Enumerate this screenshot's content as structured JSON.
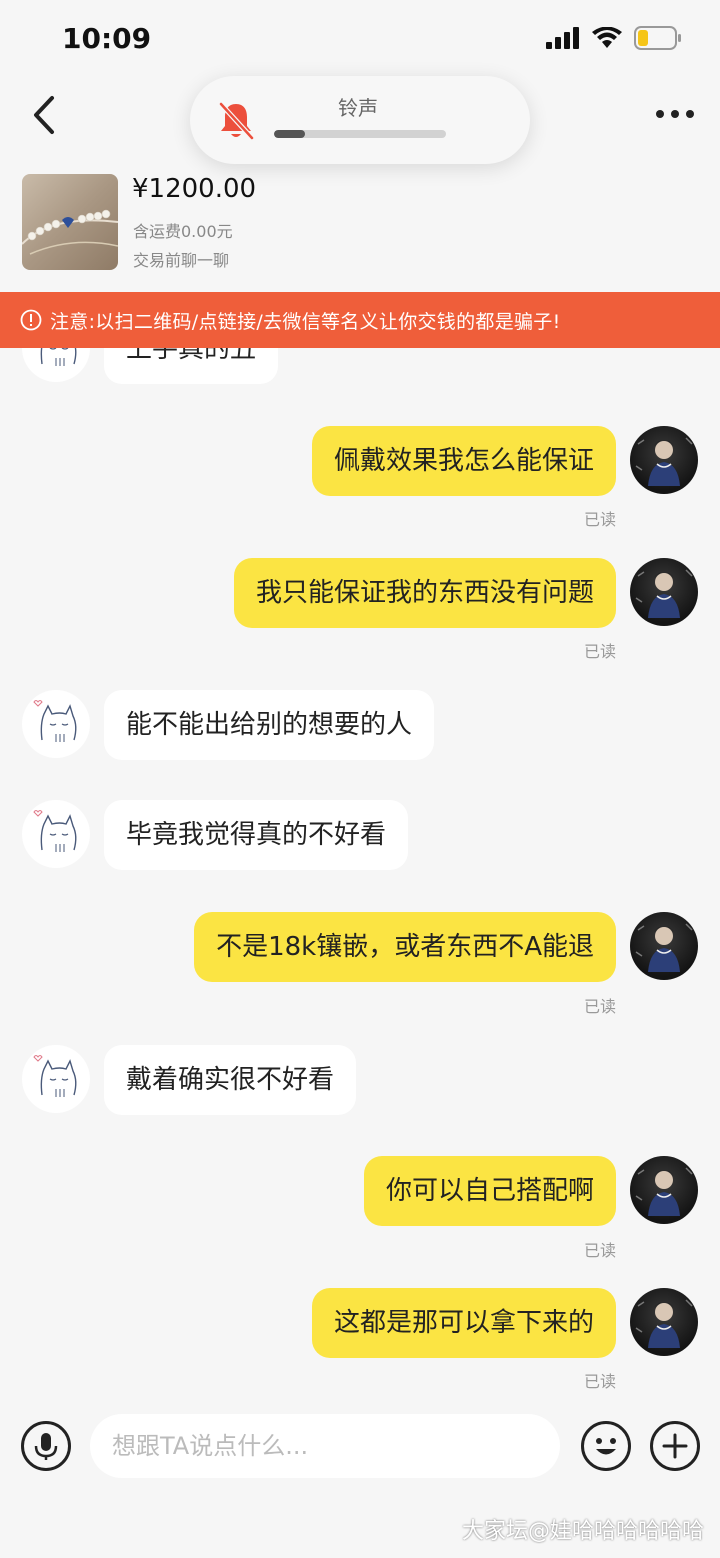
{
  "status_bar": {
    "time": "10:09"
  },
  "ringer": {
    "label": "铃声",
    "level": 0.18
  },
  "product": {
    "price": "¥1200.00",
    "shipping": "含运费0.00元",
    "chat_before_trade": "交易前聊一聊"
  },
  "warning": {
    "text": "注意:以扫二维码/点链接/去微信等名义让你交钱的都是骗子!"
  },
  "messages": [
    {
      "from": "other",
      "text": "上手真的丑"
    },
    {
      "from": "me",
      "text": "佩戴效果我怎么能保证",
      "status": "已读"
    },
    {
      "from": "me",
      "text": "我只能保证我的东西没有问题",
      "status": "已读"
    },
    {
      "from": "other",
      "text": "能不能出给别的想要的人"
    },
    {
      "from": "other",
      "text": "毕竟我觉得真的不好看"
    },
    {
      "from": "me",
      "text": "不是18k镶嵌，或者东西不A能退",
      "status": "已读"
    },
    {
      "from": "other",
      "text": "戴着确实很不好看"
    },
    {
      "from": "me",
      "text": "你可以自己搭配啊",
      "status": "已读"
    },
    {
      "from": "me",
      "text": "这都是那可以拿下来的",
      "status": "已读"
    }
  ],
  "input": {
    "placeholder": "想跟TA说点什么..."
  },
  "watermark": "大家坛@娃哈哈哈哈哈哈",
  "colors": {
    "warning": "#ef5e3a",
    "outgoing_bubble": "#fbe443",
    "incoming_bubble": "#ffffff"
  }
}
